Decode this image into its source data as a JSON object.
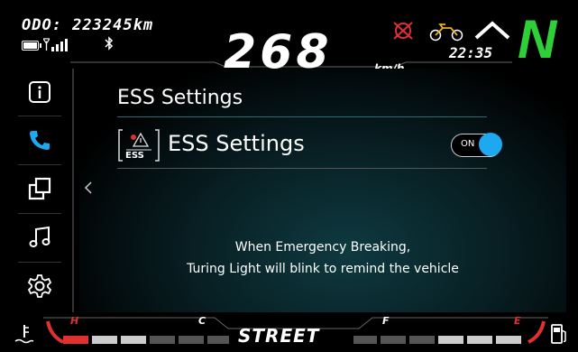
{
  "status": {
    "odo": "ODO: 223245km",
    "speed": "268",
    "speed_unit": "km/h",
    "time": "22:35",
    "gear": "N"
  },
  "sidebar": {
    "items": [
      {
        "icon": "info-icon"
      },
      {
        "icon": "phone-icon",
        "active": true
      },
      {
        "icon": "copy-icon"
      },
      {
        "icon": "music-note-icon"
      },
      {
        "icon": "settings-icon"
      }
    ]
  },
  "main": {
    "title": "ESS Settings",
    "setting": {
      "icon_text": "ESS",
      "label": "ESS Settings",
      "toggle_label": "ON",
      "toggle_on": true
    },
    "message_line1": "When Emergency Breaking,",
    "message_line2": "Turing Light will blink to remind the vehicle"
  },
  "bottom": {
    "mode": "STREET",
    "temp_hot": "H",
    "temp_cold": "C",
    "fuel_full": "F",
    "fuel_empty": "E"
  },
  "colors": {
    "accent": "#1ea8f0",
    "gear_green": "#2fcf3a",
    "warning_red": "#e03030",
    "teal_line": "#1d6f78"
  }
}
